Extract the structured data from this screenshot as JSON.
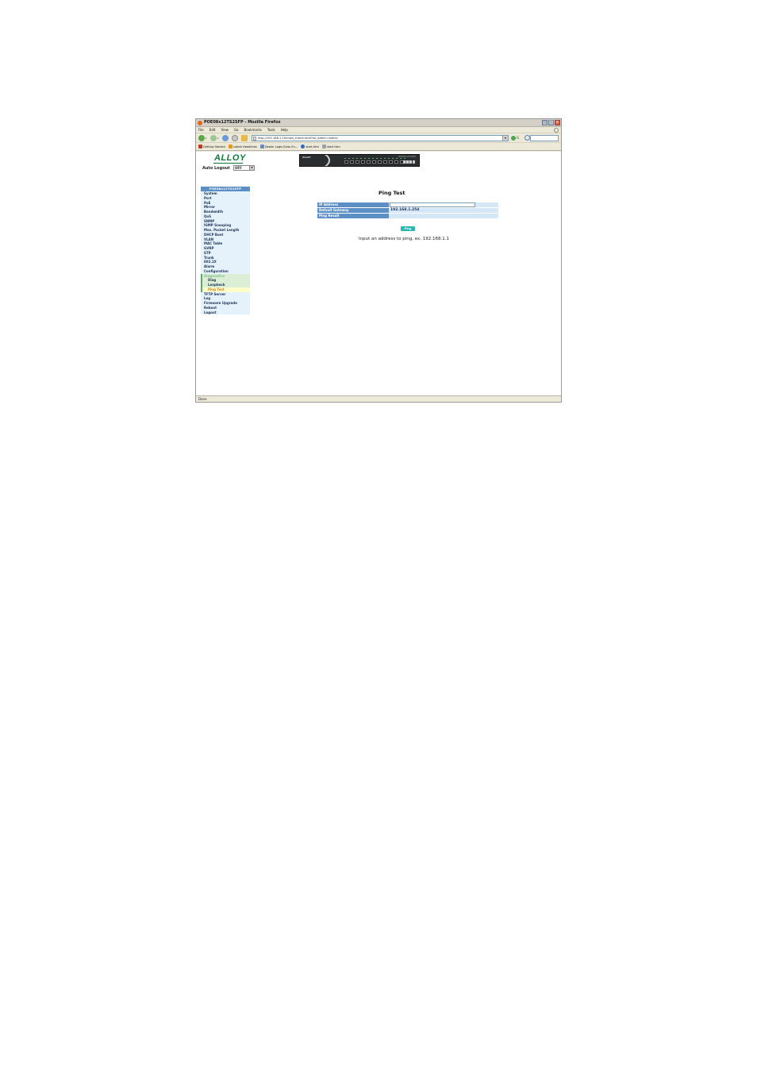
{
  "window": {
    "title": "POE08x12TS2SFP - Mozilla Firefox"
  },
  "menu": [
    "File",
    "Edit",
    "View",
    "Go",
    "Bookmarks",
    "Tools",
    "Help"
  ],
  "address_bar": {
    "url": "http://192.168.1.10/main_frame.html?rol_admin=admin"
  },
  "bookmarks": [
    {
      "label": "Getting Started",
      "color": "#c03a20"
    },
    {
      "label": "Latest Headlines",
      "color": "#e09a20"
    },
    {
      "label": "Dealer Login/Cass En...",
      "color": "#6a8ac0"
    },
    {
      "label": "start.htm",
      "color": "#2a6ac8"
    },
    {
      "label": "start.htm",
      "color": "#9aa0a8"
    }
  ],
  "header": {
    "logo": "ALLOY",
    "auto_logout_label": "Auto Logout",
    "auto_logout_value": "OFF",
    "banner_brand": "ALLOY",
    "banner_model": "POE08x12TS2SFP"
  },
  "sidebar": {
    "heading": "POE08x12TS2SFP",
    "items": [
      {
        "label": "System",
        "kind": "item"
      },
      {
        "label": "Port",
        "kind": "item"
      },
      {
        "label": "PoE",
        "kind": "item"
      },
      {
        "label": "Mirror",
        "kind": "item"
      },
      {
        "label": "Bandwidth",
        "kind": "item"
      },
      {
        "label": "QoS",
        "kind": "item"
      },
      {
        "label": "SNMP",
        "kind": "item"
      },
      {
        "label": "IGMP Snooping",
        "kind": "item"
      },
      {
        "label": "Max. Packet Length",
        "kind": "item"
      },
      {
        "label": "DHCP Boot",
        "kind": "item"
      },
      {
        "label": "VLAN",
        "kind": "item"
      },
      {
        "label": "MAC Table",
        "kind": "item"
      },
      {
        "label": "GVRP",
        "kind": "item"
      },
      {
        "label": "STP",
        "kind": "item"
      },
      {
        "label": "Trunk",
        "kind": "item"
      },
      {
        "label": "802.1X",
        "kind": "item"
      },
      {
        "label": "Alarm",
        "kind": "item"
      },
      {
        "label": "Configuration",
        "kind": "item"
      },
      {
        "label": "Diagnostics",
        "kind": "sub-parent"
      },
      {
        "label": "Diag",
        "kind": "sub"
      },
      {
        "label": "Loopback",
        "kind": "sub"
      },
      {
        "label": "Ping Test",
        "kind": "sub-active"
      },
      {
        "label": "TFTP Server",
        "kind": "item"
      },
      {
        "label": "Log",
        "kind": "item"
      },
      {
        "label": "Firmware Upgrade",
        "kind": "item"
      },
      {
        "label": "Reboot",
        "kind": "item"
      },
      {
        "label": "Logout",
        "kind": "item"
      }
    ]
  },
  "main": {
    "title": "Ping Test",
    "fields": {
      "ip_address_label": "IP Address",
      "ip_address_value": "",
      "gateway_label": "Default Gateway",
      "gateway_value": "192.168.1.254",
      "result_label": "Ping Result",
      "result_value": ""
    },
    "ping_button": "Ping",
    "hint": "Input an address to ping, ex. 192.168.1.1"
  },
  "status_bar": "Done",
  "colors": {
    "nav_header": "#5b8fc6",
    "nav_bg": "#e6f2fb",
    "active_item": "#d98020",
    "ping_button": "#2ab8b0",
    "logo": "#0f7a3a"
  }
}
